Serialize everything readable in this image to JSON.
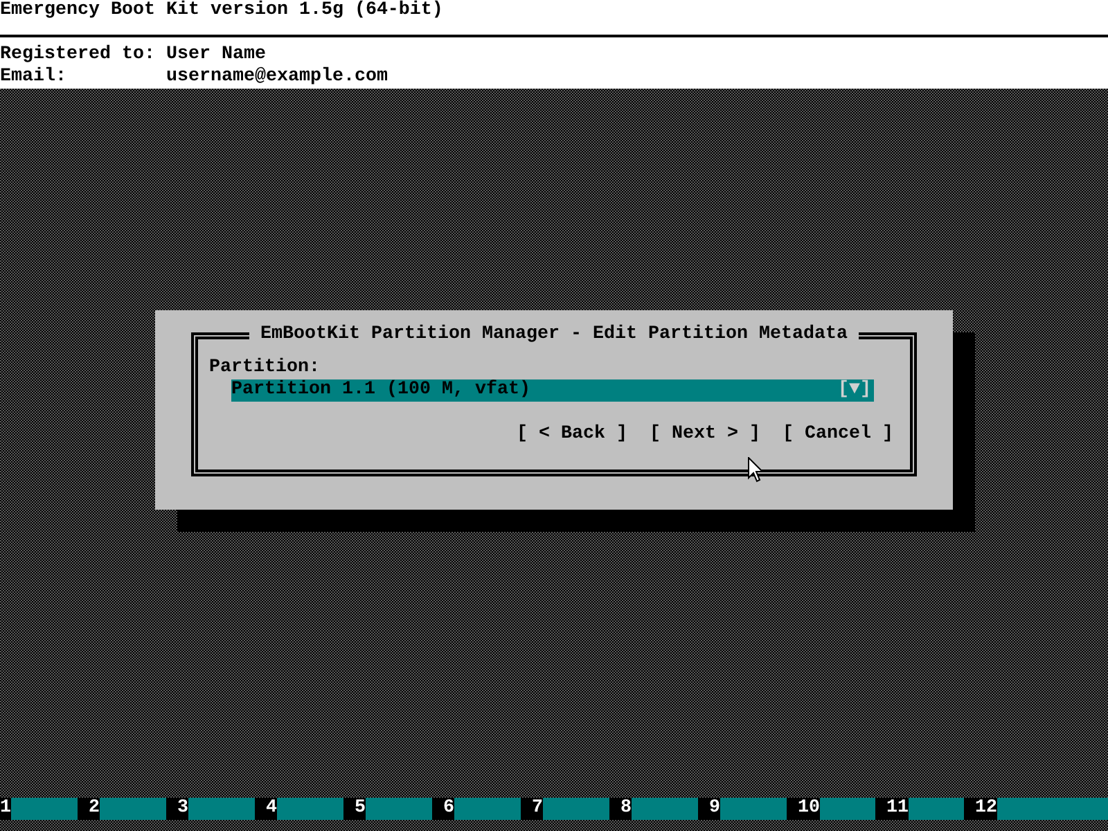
{
  "header": {
    "title": "Emergency Boot Kit version 1.5g (64-bit)",
    "fields": [
      {
        "label": "Registered to:",
        "value": "User Name"
      },
      {
        "label": "Email:",
        "value": "username@example.com"
      }
    ]
  },
  "dialog": {
    "title": "EmBootKit Partition Manager - Edit Partition Metadata",
    "field_label": "Partition:",
    "dropdown": {
      "value": "Partition 1.1 (100 M, vfat)",
      "arrow": "[▼]"
    },
    "buttons": [
      {
        "label": "[ < Back ]"
      },
      {
        "label": "[ Next > ]"
      },
      {
        "label": "[ Cancel ]"
      }
    ]
  },
  "function_keys": [
    {
      "number": "1"
    },
    {
      "number": "2"
    },
    {
      "number": "3"
    },
    {
      "number": "4"
    },
    {
      "number": "5"
    },
    {
      "number": "6"
    },
    {
      "number": "7"
    },
    {
      "number": "8"
    },
    {
      "number": "9"
    },
    {
      "number": "10"
    },
    {
      "number": "11"
    },
    {
      "number": "12"
    }
  ]
}
